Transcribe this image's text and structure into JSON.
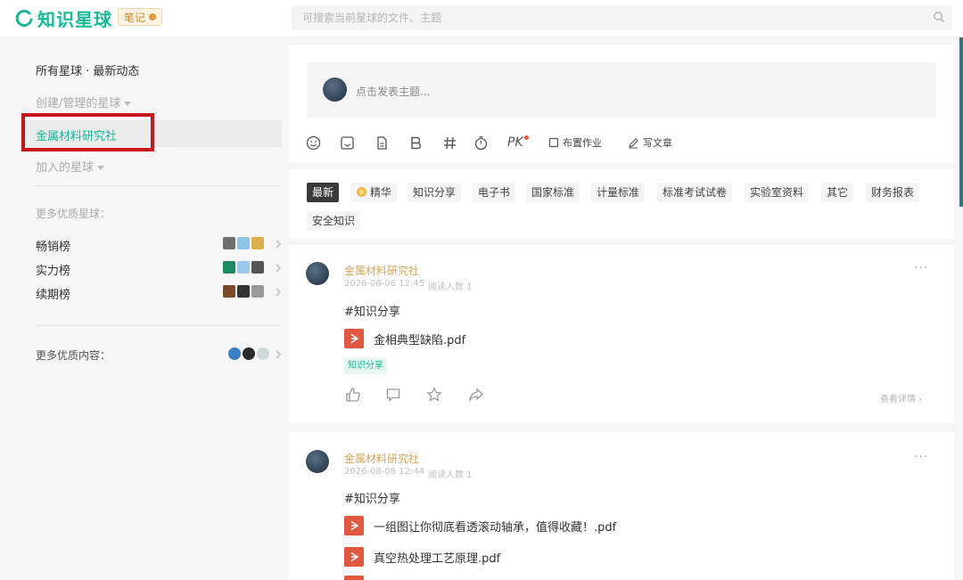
{
  "header": {
    "logo_text": "知识星球",
    "note_badge": "笔记",
    "search_placeholder": "可搜索当前星球的文件、主题"
  },
  "sidebar": {
    "all_feed": "所有星球 · 最新动态",
    "created_managed": "创建/管理的星球",
    "selected_planet": "金属材料研究社",
    "joined": "加入的星球",
    "more_planets": "更多优质星球：",
    "rankings": [
      {
        "label": "畅销榜"
      },
      {
        "label": "实力榜"
      },
      {
        "label": "续期榜"
      }
    ],
    "more_content": "更多优质内容："
  },
  "composer": {
    "placeholder": "点击发表主题...",
    "toolbar": {
      "pk": "PK",
      "assignment": "布置作业",
      "write_article": "写文章"
    }
  },
  "filters": [
    "最新",
    "精华",
    "知识分享",
    "电子书",
    "国家标准",
    "计量标准",
    "标准考试试卷",
    "实验室资料",
    "其它",
    "财务报表",
    "安全知识"
  ],
  "posts": [
    {
      "author": "金属材料研究社",
      "date": "2026-08-08 12:45",
      "reads": "阅读人数 1",
      "hashtag": "#知识分享",
      "files": [
        "金相典型缺陷.pdf"
      ],
      "tag": "知识分享",
      "more": "···",
      "view_detail": "查看详情"
    },
    {
      "author": "金属材料研究社",
      "date": "2026-08-08 12:44",
      "reads": "阅读人数 1",
      "hashtag": "#知识分享",
      "files": [
        "一组图让你彻底看透滚动轴承，值得收藏！.pdf",
        "真空热处理工艺原理.pdf"
      ],
      "more": "···"
    }
  ],
  "colors": {
    "brand_green": "#16b998",
    "author_gold": "#d5a55c",
    "highlight_red": "#c8141b",
    "pdf_red": "#e4573f"
  }
}
